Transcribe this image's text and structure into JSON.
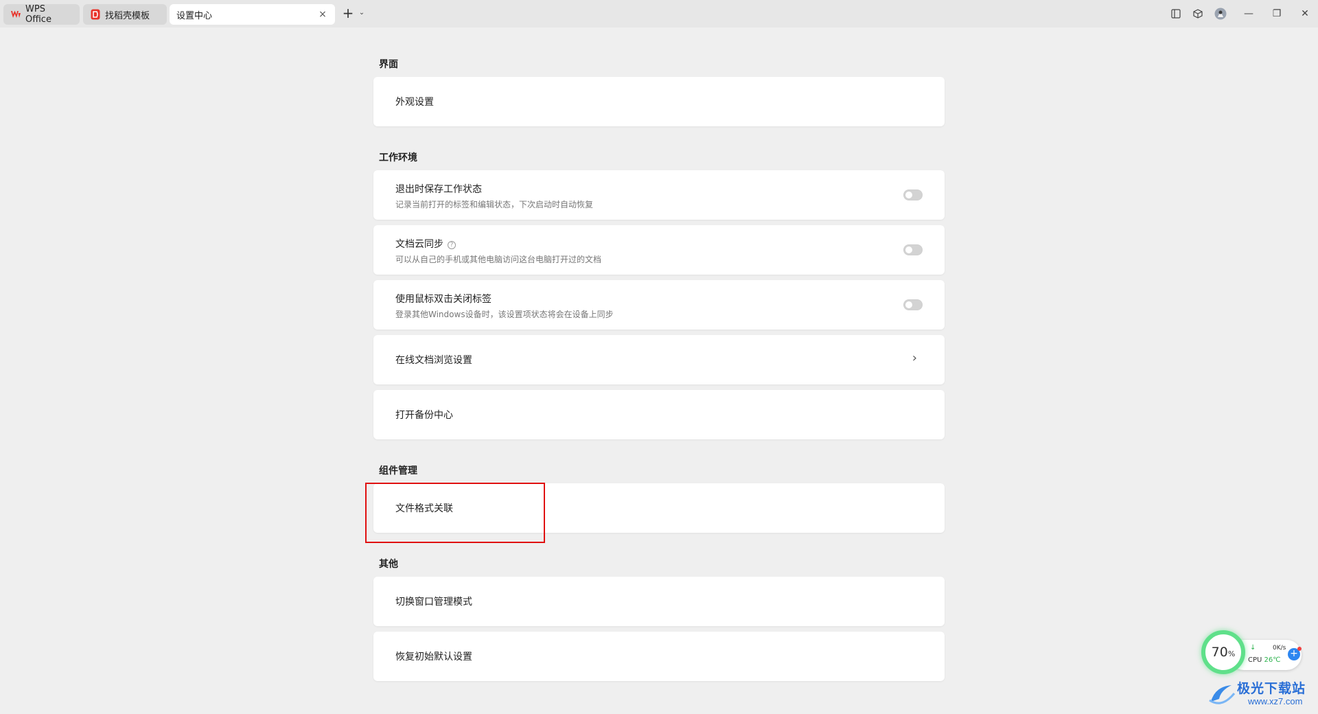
{
  "tabs": [
    {
      "label": "WPS Office"
    },
    {
      "label": "找稻壳模板"
    },
    {
      "label": "设置中心"
    }
  ],
  "tab_close_glyph": "×",
  "new_tab_glyph": "+",
  "new_tab_menu_glyph": "⌄",
  "window_controls": {
    "minimize_glyph": "—",
    "restore_glyph": "❐",
    "close_glyph": "✕"
  },
  "sections": {
    "interface": {
      "title": "界面",
      "items": [
        {
          "title": "外观设置"
        }
      ]
    },
    "workspace": {
      "title": "工作环境",
      "items": [
        {
          "title": "退出时保存工作状态",
          "desc": "记录当前打开的标签和编辑状态，下次启动时自动恢复",
          "toggle": false
        },
        {
          "title": "文档云同步",
          "desc": "可以从自己的手机或其他电脑访问这台电脑打开过的文档",
          "toggle": false,
          "help_glyph": "?"
        },
        {
          "title": "使用鼠标双击关闭标签",
          "desc": "登录其他Windows设备时，该设置项状态将会在设备上同步",
          "toggle": false
        },
        {
          "title": "在线文档浏览设置",
          "chevron": "›"
        },
        {
          "title": "打开备份中心"
        }
      ]
    },
    "components": {
      "title": "组件管理",
      "items": [
        {
          "title": "文件格式关联"
        }
      ]
    },
    "other": {
      "title": "其他",
      "items": [
        {
          "title": "切换窗口管理模式"
        },
        {
          "title": "恢复初始默认设置"
        }
      ]
    }
  },
  "monitor_widget": {
    "percent": "70",
    "percent_unit": "%",
    "arrow": "↓",
    "net_speed": "0K/s",
    "cpu_label": "CPU",
    "cpu_temp": "26℃",
    "boost_glyph": "+"
  },
  "watermark": {
    "text": "极光下载站",
    "url": "www.xz7.com"
  },
  "colors": {
    "highlight_box": "#e01010",
    "page_bg": "#efefef",
    "card_bg": "#ffffff",
    "wps_red": "#e8332a",
    "monitor_ring": "#5fe08a"
  }
}
